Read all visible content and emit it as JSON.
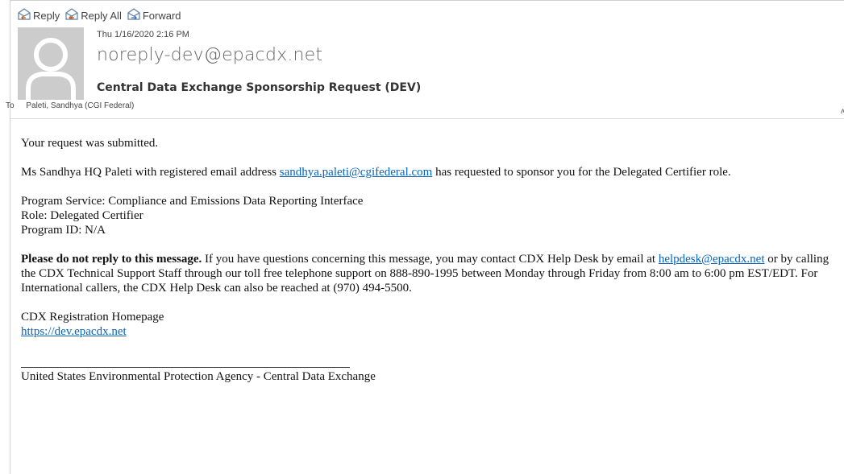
{
  "toolbar": {
    "reply": "Reply",
    "reply_all": "Reply All",
    "forward": "Forward"
  },
  "message": {
    "date": "Thu 1/16/2020 2:16 PM",
    "sender": "noreply-dev@epacdx.net",
    "subject": "Central Data Exchange Sponsorship Request (DEV)",
    "to_label": "To",
    "to_value": "Paleti, Sandhya (CGI Federal)"
  },
  "body": {
    "p1": "Your request was submitted.",
    "p2_before": "Ms Sandhya HQ Paleti with registered email address ",
    "p2_link": "sandhya.paleti@cgifederal.com",
    "p2_after": " has requested to sponsor you for the Delegated Certifier role.",
    "program_service": "Program Service: Compliance and Emissions Data Reporting Interface",
    "role": "Role: Delegated Certifier",
    "program_id": "Program ID: N/A",
    "notice_bold": "Please do not reply to this message.",
    "notice_text": " If you have questions concerning this message, you may contact CDX Help Desk by email at ",
    "helpdesk_link": "helpdesk@epacdx.net",
    "notice_text2": " or by calling the CDX Technical Support Staff through our toll free telephone support on 888-890-1995 between Monday through Friday from 8:00 am to 6:00 pm EST/EDT. For International callers, the CDX Help Desk can also be reached at (970) 494-5500.",
    "homepage_label": "CDX Registration Homepage",
    "homepage_link": "https://dev.epacdx.net",
    "footer": "United States Environmental Protection Agency - Central Data Exchange"
  }
}
